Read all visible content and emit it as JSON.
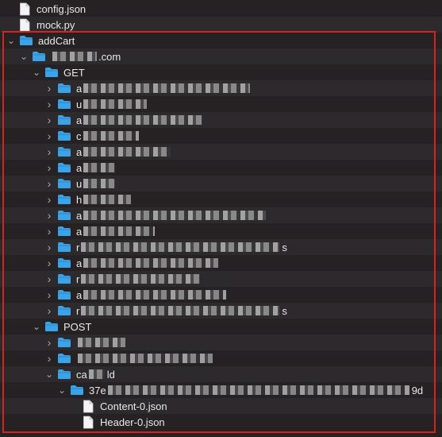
{
  "rows": [
    {
      "depth": 0,
      "kind": "file",
      "label": "config.json"
    },
    {
      "depth": 0,
      "kind": "file",
      "label": "mock.py"
    },
    {
      "depth": 0,
      "kind": "folder",
      "expanded": true,
      "label": "addCart"
    },
    {
      "depth": 1,
      "kind": "folder",
      "expanded": true,
      "label": ".com",
      "redacted_prefix": true
    },
    {
      "depth": 2,
      "kind": "folder",
      "expanded": true,
      "label": "GET"
    },
    {
      "depth": 3,
      "kind": "folder",
      "expanded": false,
      "label": "a",
      "redacted_suffix": 210
    },
    {
      "depth": 3,
      "kind": "folder",
      "expanded": false,
      "label": "u",
      "redacted_suffix": 80
    },
    {
      "depth": 3,
      "kind": "folder",
      "expanded": false,
      "label": "a",
      "redacted_suffix": 150
    },
    {
      "depth": 3,
      "kind": "folder",
      "expanded": false,
      "label": "c",
      "redacted_suffix": 70
    },
    {
      "depth": 3,
      "kind": "folder",
      "expanded": false,
      "label": "a",
      "redacted_suffix": 110
    },
    {
      "depth": 3,
      "kind": "folder",
      "expanded": false,
      "label": "a",
      "redacted_suffix": 40
    },
    {
      "depth": 3,
      "kind": "folder",
      "expanded": false,
      "label": "u",
      "redacted_suffix": 40
    },
    {
      "depth": 3,
      "kind": "folder",
      "expanded": false,
      "label": "h",
      "redacted_suffix": 60
    },
    {
      "depth": 3,
      "kind": "folder",
      "expanded": false,
      "label": "a",
      "redacted_suffix": 230
    },
    {
      "depth": 3,
      "kind": "folder",
      "expanded": false,
      "label": "a",
      "redacted_suffix": 90
    },
    {
      "depth": 3,
      "kind": "folder",
      "expanded": false,
      "label": "r",
      "redacted_suffix": 250,
      "tail": "s"
    },
    {
      "depth": 3,
      "kind": "folder",
      "expanded": false,
      "label": "a",
      "redacted_suffix": 170
    },
    {
      "depth": 3,
      "kind": "folder",
      "expanded": false,
      "label": "r",
      "redacted_suffix": 150
    },
    {
      "depth": 3,
      "kind": "folder",
      "expanded": false,
      "label": "a",
      "redacted_suffix": 180
    },
    {
      "depth": 3,
      "kind": "folder",
      "expanded": false,
      "label": "r",
      "redacted_suffix": 250,
      "tail": "s"
    },
    {
      "depth": 2,
      "kind": "folder",
      "expanded": true,
      "label": "POST"
    },
    {
      "depth": 3,
      "kind": "folder",
      "expanded": false,
      "label": "",
      "redacted_suffix": 60
    },
    {
      "depth": 3,
      "kind": "folder",
      "expanded": false,
      "label": "",
      "redacted_suffix": 170
    },
    {
      "depth": 3,
      "kind": "folder",
      "expanded": true,
      "label": "ca",
      "redacted_suffix": 20,
      "tail": "ld"
    },
    {
      "depth": 4,
      "kind": "folder",
      "expanded": true,
      "label": "37e",
      "redacted_suffix": 380,
      "tail": "9d"
    },
    {
      "depth": 5,
      "kind": "file",
      "label": "Content-0.json"
    },
    {
      "depth": 5,
      "kind": "file",
      "label": "Header-0.json"
    }
  ],
  "colors": {
    "background": "#262224",
    "row_alt": "#2c2a2c",
    "folder": "#3ba4e8",
    "highlight_border": "#d6231e"
  },
  "icons": {
    "folder": "folder-icon",
    "file": "file-icon",
    "expanded": "chevron-down-icon",
    "collapsed": "chevron-right-icon"
  }
}
